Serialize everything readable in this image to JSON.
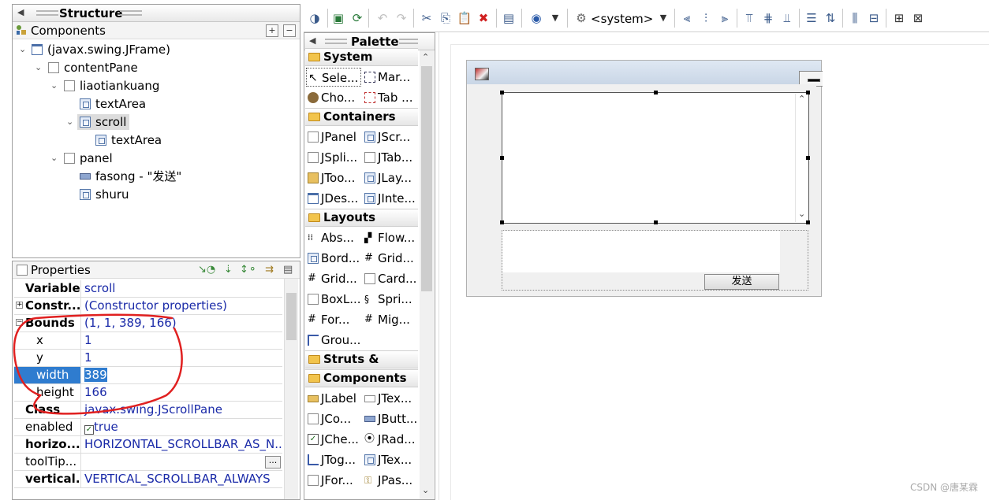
{
  "structure": {
    "title": "Structure",
    "components_label": "Components",
    "tree": [
      {
        "label": "(javax.swing.JFrame)",
        "icon": "jframe-icon"
      },
      {
        "label": "contentPane",
        "icon": "panel-icon"
      },
      {
        "label": "liaotiankuang",
        "icon": "panel-icon"
      },
      {
        "label": "textArea",
        "icon": "textarea-icon"
      },
      {
        "label": "scroll",
        "icon": "scrollpane-icon"
      },
      {
        "label": "textArea",
        "icon": "textarea-icon"
      },
      {
        "label": "panel",
        "icon": "panel-icon"
      },
      {
        "label": "fasong - \"发送\"",
        "icon": "button-icon"
      },
      {
        "label": "shuru",
        "icon": "textarea-icon"
      }
    ]
  },
  "properties": {
    "title": "Properties",
    "rows": [
      {
        "name": "Variable",
        "value": "scroll"
      },
      {
        "name": "Constr...",
        "value": "(Constructor properties)"
      },
      {
        "name": "Bounds",
        "value": "(1, 1, 389, 166)"
      },
      {
        "name": "x",
        "value": "1"
      },
      {
        "name": "y",
        "value": "1"
      },
      {
        "name": "width",
        "value": "389"
      },
      {
        "name": "height",
        "value": "166"
      },
      {
        "name": "Class",
        "value": "javax.swing.JScrollPane"
      },
      {
        "name": "enabled",
        "value": "true"
      },
      {
        "name": "horizo...",
        "value": "HORIZONTAL_SCROLLBAR_AS_N..."
      },
      {
        "name": "toolTip...",
        "value": ""
      },
      {
        "name": "vertical...",
        "value": "VERTICAL_SCROLLBAR_ALWAYS"
      }
    ],
    "ellipsis_button": "..."
  },
  "toolbar": {
    "look_and_feel": "<system>"
  },
  "palette": {
    "title": "Palette",
    "categories": {
      "system": "System",
      "containers": "Containers",
      "layouts": "Layouts",
      "struts": "Struts & Sprin...",
      "components": "Components"
    },
    "system_items": [
      "Sele...",
      "Mar...",
      "Cho...",
      "Tab ..."
    ],
    "container_items": [
      "JPanel",
      "JScr...",
      "JSpli...",
      "JTab...",
      "JToo...",
      "JLay...",
      "JDes...",
      "JInte..."
    ],
    "layout_items": [
      "Abs...",
      "Flow...",
      "Bord...",
      "Grid...",
      "Grid...",
      "Card...",
      "BoxL...",
      "Spri...",
      "For...",
      "Mig...",
      "Grou..."
    ],
    "component_items": [
      "JLabel",
      "JTex...",
      "JCo...",
      "JButt...",
      "JChe...",
      "JRad...",
      "JTog...",
      "JTex...",
      "JFor...",
      "JPas..."
    ]
  },
  "design": {
    "send_button_label": "发送"
  },
  "watermark": "CSDN @唐某霖",
  "colors": {
    "selection": "#2f7ccf",
    "annotation_red": "#e02020",
    "value_blue": "#1a2aa8"
  }
}
